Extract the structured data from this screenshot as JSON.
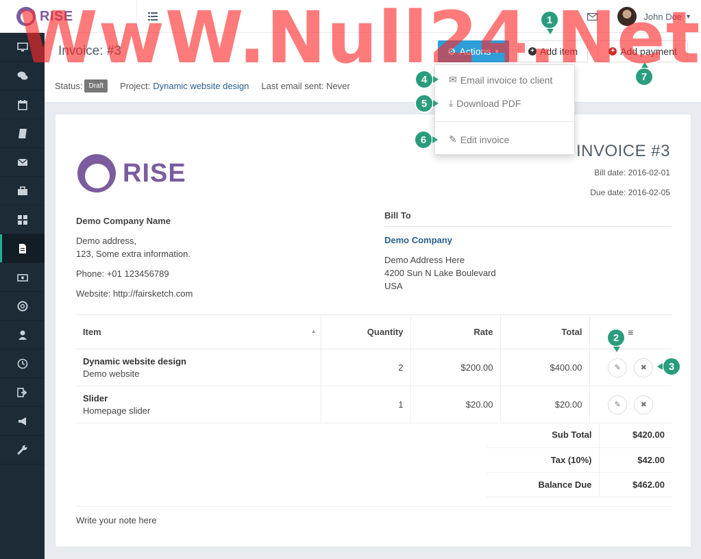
{
  "app": {
    "brand": "RISE"
  },
  "topbar": {
    "user_name": "John Doe"
  },
  "sidebar": {
    "items": [
      {
        "icon": "monitor-icon"
      },
      {
        "icon": "chat-icon"
      },
      {
        "icon": "calendar-icon"
      },
      {
        "icon": "book-icon"
      },
      {
        "icon": "envelope-icon"
      },
      {
        "icon": "briefcase-icon"
      },
      {
        "icon": "grid-icon"
      },
      {
        "icon": "document-icon",
        "active": true
      },
      {
        "icon": "money-icon"
      },
      {
        "icon": "lifebuoy-icon"
      },
      {
        "icon": "user-icon"
      },
      {
        "icon": "clock-icon"
      },
      {
        "icon": "sign-out-icon"
      },
      {
        "icon": "megaphone-icon"
      },
      {
        "icon": "wrench-icon"
      }
    ]
  },
  "header": {
    "title": "Invoice: #3",
    "actions_label": "Actions",
    "add_item_label": "Add item",
    "add_payment_label": "Add payment",
    "status_label": "Status:",
    "status_value": "Draft",
    "project_label": "Project:",
    "project_value": "Dynamic website design",
    "last_email_label": "Last email sent: Never"
  },
  "actions_menu": {
    "email": "Email invoice to client",
    "download": "Download PDF",
    "edit": "Edit invoice"
  },
  "invoice": {
    "title": "INVOICE #3",
    "bill_date": "Bill date: 2016-02-01",
    "due_date": "Due date: 2016-02-05",
    "logo_text": "RISE",
    "company": {
      "name": "Demo Company Name",
      "address_1": "Demo address,",
      "address_2": "123, Some extra information.",
      "phone": "Phone: +01 123456789",
      "website": "Website: http://fairsketch.com"
    },
    "bill_to": {
      "heading": "Bill To",
      "client": "Demo Company",
      "address_1": "Demo Address Here",
      "address_2": "4200 Sun N Lake Boulevard",
      "country": "USA"
    },
    "columns": {
      "item": "Item",
      "quantity": "Quantity",
      "rate": "Rate",
      "total": "Total"
    },
    "items": [
      {
        "title": "Dynamic website design",
        "description": "Demo website",
        "quantity": "2",
        "rate": "$200.00",
        "total": "$400.00"
      },
      {
        "title": "Slider",
        "description": "Homepage slider",
        "quantity": "1",
        "rate": "$20.00",
        "total": "$20.00"
      }
    ],
    "totals": {
      "subtotal_label": "Sub Total",
      "subtotal_value": "$420.00",
      "tax_label": "Tax (10%)",
      "tax_value": "$42.00",
      "balance_label": "Balance Due",
      "balance_value": "$462.00"
    },
    "note": "Write your note here"
  },
  "markers": [
    "1",
    "2",
    "3",
    "4",
    "5",
    "6",
    "7"
  ],
  "watermark": "WwW.Null24.Net",
  "colors": {
    "primary": "#2d9ed8",
    "brand": "#7b5c9e",
    "sidebar": "#1c2b36",
    "marker": "#2a9d7d",
    "link": "#286090",
    "watermark": "#ff2828"
  }
}
